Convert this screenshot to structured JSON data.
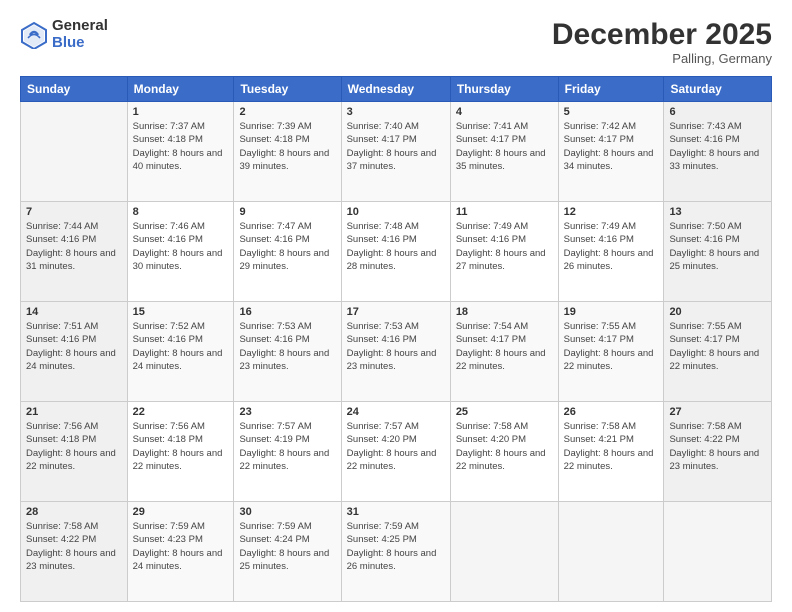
{
  "header": {
    "logo_general": "General",
    "logo_blue": "Blue",
    "month_title": "December 2025",
    "location": "Palling, Germany"
  },
  "weekdays": [
    "Sunday",
    "Monday",
    "Tuesday",
    "Wednesday",
    "Thursday",
    "Friday",
    "Saturday"
  ],
  "weeks": [
    [
      {
        "day": "",
        "sunrise": "",
        "sunset": "",
        "daylight": ""
      },
      {
        "day": "1",
        "sunrise": "Sunrise: 7:37 AM",
        "sunset": "Sunset: 4:18 PM",
        "daylight": "Daylight: 8 hours and 40 minutes."
      },
      {
        "day": "2",
        "sunrise": "Sunrise: 7:39 AM",
        "sunset": "Sunset: 4:18 PM",
        "daylight": "Daylight: 8 hours and 39 minutes."
      },
      {
        "day": "3",
        "sunrise": "Sunrise: 7:40 AM",
        "sunset": "Sunset: 4:17 PM",
        "daylight": "Daylight: 8 hours and 37 minutes."
      },
      {
        "day": "4",
        "sunrise": "Sunrise: 7:41 AM",
        "sunset": "Sunset: 4:17 PM",
        "daylight": "Daylight: 8 hours and 35 minutes."
      },
      {
        "day": "5",
        "sunrise": "Sunrise: 7:42 AM",
        "sunset": "Sunset: 4:17 PM",
        "daylight": "Daylight: 8 hours and 34 minutes."
      },
      {
        "day": "6",
        "sunrise": "Sunrise: 7:43 AM",
        "sunset": "Sunset: 4:16 PM",
        "daylight": "Daylight: 8 hours and 33 minutes."
      }
    ],
    [
      {
        "day": "7",
        "sunrise": "Sunrise: 7:44 AM",
        "sunset": "Sunset: 4:16 PM",
        "daylight": "Daylight: 8 hours and 31 minutes."
      },
      {
        "day": "8",
        "sunrise": "Sunrise: 7:46 AM",
        "sunset": "Sunset: 4:16 PM",
        "daylight": "Daylight: 8 hours and 30 minutes."
      },
      {
        "day": "9",
        "sunrise": "Sunrise: 7:47 AM",
        "sunset": "Sunset: 4:16 PM",
        "daylight": "Daylight: 8 hours and 29 minutes."
      },
      {
        "day": "10",
        "sunrise": "Sunrise: 7:48 AM",
        "sunset": "Sunset: 4:16 PM",
        "daylight": "Daylight: 8 hours and 28 minutes."
      },
      {
        "day": "11",
        "sunrise": "Sunrise: 7:49 AM",
        "sunset": "Sunset: 4:16 PM",
        "daylight": "Daylight: 8 hours and 27 minutes."
      },
      {
        "day": "12",
        "sunrise": "Sunrise: 7:49 AM",
        "sunset": "Sunset: 4:16 PM",
        "daylight": "Daylight: 8 hours and 26 minutes."
      },
      {
        "day": "13",
        "sunrise": "Sunrise: 7:50 AM",
        "sunset": "Sunset: 4:16 PM",
        "daylight": "Daylight: 8 hours and 25 minutes."
      }
    ],
    [
      {
        "day": "14",
        "sunrise": "Sunrise: 7:51 AM",
        "sunset": "Sunset: 4:16 PM",
        "daylight": "Daylight: 8 hours and 24 minutes."
      },
      {
        "day": "15",
        "sunrise": "Sunrise: 7:52 AM",
        "sunset": "Sunset: 4:16 PM",
        "daylight": "Daylight: 8 hours and 24 minutes."
      },
      {
        "day": "16",
        "sunrise": "Sunrise: 7:53 AM",
        "sunset": "Sunset: 4:16 PM",
        "daylight": "Daylight: 8 hours and 23 minutes."
      },
      {
        "day": "17",
        "sunrise": "Sunrise: 7:53 AM",
        "sunset": "Sunset: 4:16 PM",
        "daylight": "Daylight: 8 hours and 23 minutes."
      },
      {
        "day": "18",
        "sunrise": "Sunrise: 7:54 AM",
        "sunset": "Sunset: 4:17 PM",
        "daylight": "Daylight: 8 hours and 22 minutes."
      },
      {
        "day": "19",
        "sunrise": "Sunrise: 7:55 AM",
        "sunset": "Sunset: 4:17 PM",
        "daylight": "Daylight: 8 hours and 22 minutes."
      },
      {
        "day": "20",
        "sunrise": "Sunrise: 7:55 AM",
        "sunset": "Sunset: 4:17 PM",
        "daylight": "Daylight: 8 hours and 22 minutes."
      }
    ],
    [
      {
        "day": "21",
        "sunrise": "Sunrise: 7:56 AM",
        "sunset": "Sunset: 4:18 PM",
        "daylight": "Daylight: 8 hours and 22 minutes."
      },
      {
        "day": "22",
        "sunrise": "Sunrise: 7:56 AM",
        "sunset": "Sunset: 4:18 PM",
        "daylight": "Daylight: 8 hours and 22 minutes."
      },
      {
        "day": "23",
        "sunrise": "Sunrise: 7:57 AM",
        "sunset": "Sunset: 4:19 PM",
        "daylight": "Daylight: 8 hours and 22 minutes."
      },
      {
        "day": "24",
        "sunrise": "Sunrise: 7:57 AM",
        "sunset": "Sunset: 4:20 PM",
        "daylight": "Daylight: 8 hours and 22 minutes."
      },
      {
        "day": "25",
        "sunrise": "Sunrise: 7:58 AM",
        "sunset": "Sunset: 4:20 PM",
        "daylight": "Daylight: 8 hours and 22 minutes."
      },
      {
        "day": "26",
        "sunrise": "Sunrise: 7:58 AM",
        "sunset": "Sunset: 4:21 PM",
        "daylight": "Daylight: 8 hours and 22 minutes."
      },
      {
        "day": "27",
        "sunrise": "Sunrise: 7:58 AM",
        "sunset": "Sunset: 4:22 PM",
        "daylight": "Daylight: 8 hours and 23 minutes."
      }
    ],
    [
      {
        "day": "28",
        "sunrise": "Sunrise: 7:58 AM",
        "sunset": "Sunset: 4:22 PM",
        "daylight": "Daylight: 8 hours and 23 minutes."
      },
      {
        "day": "29",
        "sunrise": "Sunrise: 7:59 AM",
        "sunset": "Sunset: 4:23 PM",
        "daylight": "Daylight: 8 hours and 24 minutes."
      },
      {
        "day": "30",
        "sunrise": "Sunrise: 7:59 AM",
        "sunset": "Sunset: 4:24 PM",
        "daylight": "Daylight: 8 hours and 25 minutes."
      },
      {
        "day": "31",
        "sunrise": "Sunrise: 7:59 AM",
        "sunset": "Sunset: 4:25 PM",
        "daylight": "Daylight: 8 hours and 26 minutes."
      },
      {
        "day": "",
        "sunrise": "",
        "sunset": "",
        "daylight": ""
      },
      {
        "day": "",
        "sunrise": "",
        "sunset": "",
        "daylight": ""
      },
      {
        "day": "",
        "sunrise": "",
        "sunset": "",
        "daylight": ""
      }
    ]
  ]
}
